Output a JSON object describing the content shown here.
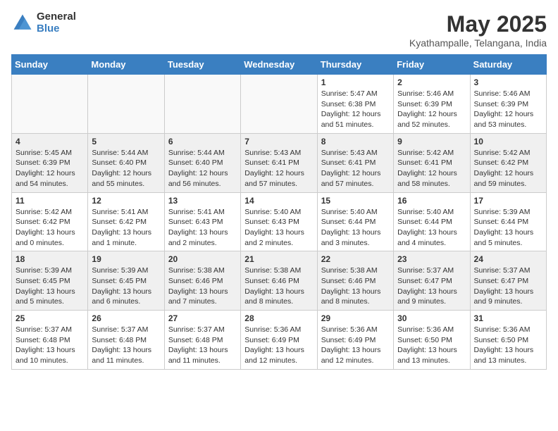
{
  "header": {
    "logo_general": "General",
    "logo_blue": "Blue",
    "title": "May 2025",
    "subtitle": "Kyathampalle, Telangana, India"
  },
  "days_of_week": [
    "Sunday",
    "Monday",
    "Tuesday",
    "Wednesday",
    "Thursday",
    "Friday",
    "Saturday"
  ],
  "weeks": [
    [
      {
        "day": "",
        "info": "",
        "empty": true
      },
      {
        "day": "",
        "info": "",
        "empty": true
      },
      {
        "day": "",
        "info": "",
        "empty": true
      },
      {
        "day": "",
        "info": "",
        "empty": true
      },
      {
        "day": "1",
        "info": "Sunrise: 5:47 AM\nSunset: 6:38 PM\nDaylight: 12 hours and 51 minutes.",
        "empty": false
      },
      {
        "day": "2",
        "info": "Sunrise: 5:46 AM\nSunset: 6:39 PM\nDaylight: 12 hours and 52 minutes.",
        "empty": false
      },
      {
        "day": "3",
        "info": "Sunrise: 5:46 AM\nSunset: 6:39 PM\nDaylight: 12 hours and 53 minutes.",
        "empty": false
      }
    ],
    [
      {
        "day": "4",
        "info": "Sunrise: 5:45 AM\nSunset: 6:39 PM\nDaylight: 12 hours and 54 minutes.",
        "empty": false
      },
      {
        "day": "5",
        "info": "Sunrise: 5:44 AM\nSunset: 6:40 PM\nDaylight: 12 hours and 55 minutes.",
        "empty": false
      },
      {
        "day": "6",
        "info": "Sunrise: 5:44 AM\nSunset: 6:40 PM\nDaylight: 12 hours and 56 minutes.",
        "empty": false
      },
      {
        "day": "7",
        "info": "Sunrise: 5:43 AM\nSunset: 6:41 PM\nDaylight: 12 hours and 57 minutes.",
        "empty": false
      },
      {
        "day": "8",
        "info": "Sunrise: 5:43 AM\nSunset: 6:41 PM\nDaylight: 12 hours and 57 minutes.",
        "empty": false
      },
      {
        "day": "9",
        "info": "Sunrise: 5:42 AM\nSunset: 6:41 PM\nDaylight: 12 hours and 58 minutes.",
        "empty": false
      },
      {
        "day": "10",
        "info": "Sunrise: 5:42 AM\nSunset: 6:42 PM\nDaylight: 12 hours and 59 minutes.",
        "empty": false
      }
    ],
    [
      {
        "day": "11",
        "info": "Sunrise: 5:42 AM\nSunset: 6:42 PM\nDaylight: 13 hours and 0 minutes.",
        "empty": false
      },
      {
        "day": "12",
        "info": "Sunrise: 5:41 AM\nSunset: 6:42 PM\nDaylight: 13 hours and 1 minute.",
        "empty": false
      },
      {
        "day": "13",
        "info": "Sunrise: 5:41 AM\nSunset: 6:43 PM\nDaylight: 13 hours and 2 minutes.",
        "empty": false
      },
      {
        "day": "14",
        "info": "Sunrise: 5:40 AM\nSunset: 6:43 PM\nDaylight: 13 hours and 2 minutes.",
        "empty": false
      },
      {
        "day": "15",
        "info": "Sunrise: 5:40 AM\nSunset: 6:44 PM\nDaylight: 13 hours and 3 minutes.",
        "empty": false
      },
      {
        "day": "16",
        "info": "Sunrise: 5:40 AM\nSunset: 6:44 PM\nDaylight: 13 hours and 4 minutes.",
        "empty": false
      },
      {
        "day": "17",
        "info": "Sunrise: 5:39 AM\nSunset: 6:44 PM\nDaylight: 13 hours and 5 minutes.",
        "empty": false
      }
    ],
    [
      {
        "day": "18",
        "info": "Sunrise: 5:39 AM\nSunset: 6:45 PM\nDaylight: 13 hours and 5 minutes.",
        "empty": false
      },
      {
        "day": "19",
        "info": "Sunrise: 5:39 AM\nSunset: 6:45 PM\nDaylight: 13 hours and 6 minutes.",
        "empty": false
      },
      {
        "day": "20",
        "info": "Sunrise: 5:38 AM\nSunset: 6:46 PM\nDaylight: 13 hours and 7 minutes.",
        "empty": false
      },
      {
        "day": "21",
        "info": "Sunrise: 5:38 AM\nSunset: 6:46 PM\nDaylight: 13 hours and 8 minutes.",
        "empty": false
      },
      {
        "day": "22",
        "info": "Sunrise: 5:38 AM\nSunset: 6:46 PM\nDaylight: 13 hours and 8 minutes.",
        "empty": false
      },
      {
        "day": "23",
        "info": "Sunrise: 5:37 AM\nSunset: 6:47 PM\nDaylight: 13 hours and 9 minutes.",
        "empty": false
      },
      {
        "day": "24",
        "info": "Sunrise: 5:37 AM\nSunset: 6:47 PM\nDaylight: 13 hours and 9 minutes.",
        "empty": false
      }
    ],
    [
      {
        "day": "25",
        "info": "Sunrise: 5:37 AM\nSunset: 6:48 PM\nDaylight: 13 hours and 10 minutes.",
        "empty": false
      },
      {
        "day": "26",
        "info": "Sunrise: 5:37 AM\nSunset: 6:48 PM\nDaylight: 13 hours and 11 minutes.",
        "empty": false
      },
      {
        "day": "27",
        "info": "Sunrise: 5:37 AM\nSunset: 6:48 PM\nDaylight: 13 hours and 11 minutes.",
        "empty": false
      },
      {
        "day": "28",
        "info": "Sunrise: 5:36 AM\nSunset: 6:49 PM\nDaylight: 13 hours and 12 minutes.",
        "empty": false
      },
      {
        "day": "29",
        "info": "Sunrise: 5:36 AM\nSunset: 6:49 PM\nDaylight: 13 hours and 12 minutes.",
        "empty": false
      },
      {
        "day": "30",
        "info": "Sunrise: 5:36 AM\nSunset: 6:50 PM\nDaylight: 13 hours and 13 minutes.",
        "empty": false
      },
      {
        "day": "31",
        "info": "Sunrise: 5:36 AM\nSunset: 6:50 PM\nDaylight: 13 hours and 13 minutes.",
        "empty": false
      }
    ]
  ],
  "accent_color": "#3a7fc1"
}
